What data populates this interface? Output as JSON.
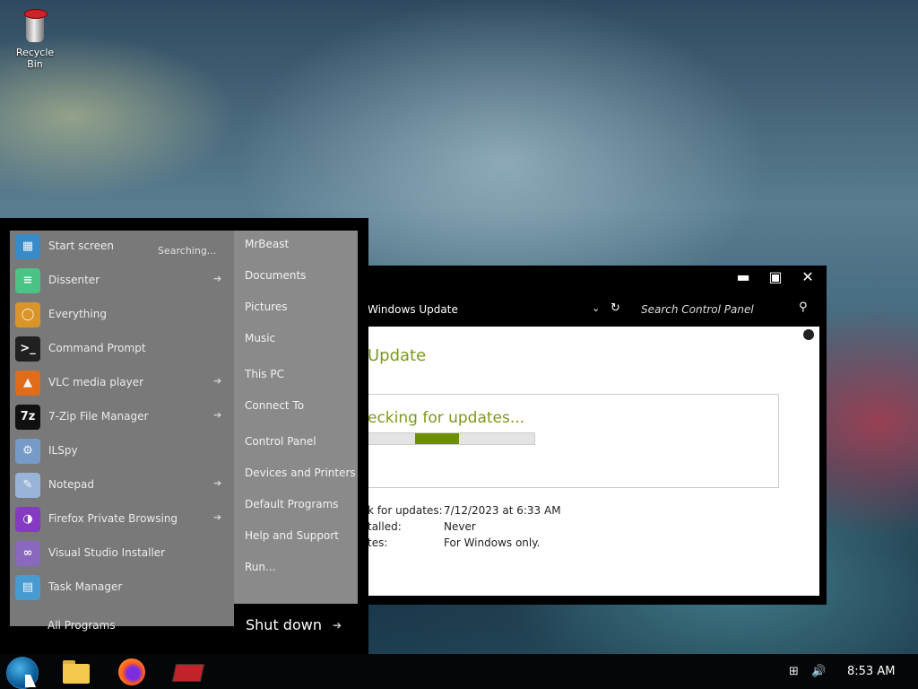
{
  "desktop": {
    "recycle_bin_label": "Recycle Bin"
  },
  "window": {
    "controls": {
      "minimize": "▬",
      "maximize": "▣",
      "close": "✕"
    },
    "breadcrumb": "Windows Update",
    "search_placeholder": "Search Control Panel",
    "title": "Update",
    "status_message": "ecking for updates...",
    "progress": 0.35,
    "info": [
      {
        "key": "k for updates:",
        "value": "7/12/2023 at 6:33 AM"
      },
      {
        "key": "talled:",
        "value": "Never"
      },
      {
        "key": "tes:",
        "value": "For Windows only."
      }
    ]
  },
  "start_menu": {
    "searching": "Searching...",
    "items": [
      {
        "label": "Start screen",
        "icon": "start-screen-icon",
        "arrow": false
      },
      {
        "label": "Dissenter",
        "icon": "dissenter-icon",
        "arrow": true
      },
      {
        "label": "Everything",
        "icon": "everything-icon",
        "arrow": false
      },
      {
        "label": "Command Prompt",
        "icon": "command-prompt-icon",
        "arrow": false
      },
      {
        "label": "VLC media player",
        "icon": "vlc-icon",
        "arrow": true
      },
      {
        "label": "7-Zip File Manager",
        "icon": "7zip-icon",
        "arrow": true
      },
      {
        "label": "ILSpy",
        "icon": "ilspy-icon",
        "arrow": false
      },
      {
        "label": "Notepad",
        "icon": "notepad-icon",
        "arrow": true
      },
      {
        "label": "Firefox Private Browsing",
        "icon": "firefox-private-icon",
        "arrow": true
      },
      {
        "label": "Visual Studio Installer",
        "icon": "visual-studio-icon",
        "arrow": false
      },
      {
        "label": "Task Manager",
        "icon": "task-manager-icon",
        "arrow": false
      }
    ],
    "all_programs": "All Programs",
    "right_items": [
      "MrBeast",
      "Documents",
      "Pictures",
      "Music",
      "This PC",
      "Connect To",
      "Control Panel",
      "Devices and Printers",
      "Default Programs",
      "Help and Support",
      "Run..."
    ],
    "shutdown_label": "Shut down",
    "shutdown_arrow": "➔"
  },
  "taskbar": {
    "clock": "8:53 AM"
  }
}
